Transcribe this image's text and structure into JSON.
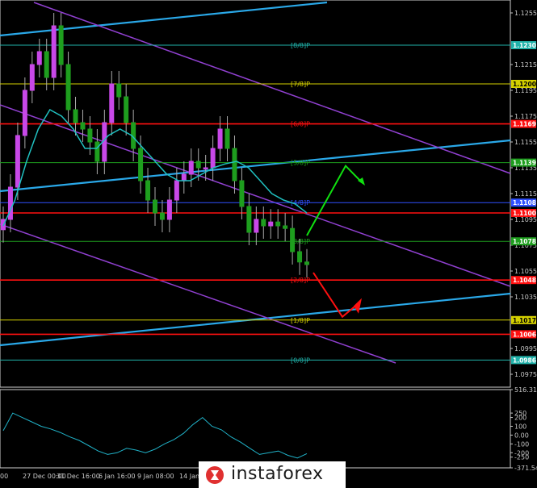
{
  "chart_data": [
    {
      "type": "line",
      "panel": "price",
      "symbol_hint": "candlestick price chart",
      "ylim": [
        1.0965,
        1.1265
      ],
      "y_ticks": [
        "1.1255",
        "1.1215",
        "1.1195",
        "1.1175",
        "1.1155",
        "1.1135",
        "1.1115",
        "1.1095",
        "1.1075",
        "1.1055",
        "1.1035",
        "1.0995",
        "1.0975"
      ],
      "x_ticks": [
        "00",
        "27 Dec 00:00",
        "31 Dec 16:00",
        "6 Jan 16:00",
        "9 Jan 08:00",
        "14 Jan"
      ],
      "murrey_levels": [
        {
          "label": "[8/8]P",
          "value": 1.123,
          "tag": "1.1230",
          "color": "#20b2aa"
        },
        {
          "label": "[7/8]P",
          "value": 1.12,
          "tag": "1.1200",
          "color": "#d4d000"
        },
        {
          "label": "[6/8]P",
          "value": 1.1169,
          "tag": "1.1169",
          "color": "#ff1010"
        },
        {
          "label": "[5/8]P",
          "value": 1.1139,
          "tag": "1.1139",
          "color": "#1e9e1e"
        },
        {
          "label": "[4/8]P",
          "value": 1.1108,
          "tag": "1.1108",
          "color": "#3050ff"
        },
        {
          "label": "",
          "value": 1.11,
          "tag": "1.1100",
          "color": "#ff1010"
        },
        {
          "label": "[3/8]P",
          "value": 1.1078,
          "tag": "1.1078",
          "color": "#1e9e1e"
        },
        {
          "label": "[2/8]P",
          "value": 1.1048,
          "tag": "1.1048",
          "color": "#ff1010"
        },
        {
          "label": "[1/8]P",
          "value": 1.1017,
          "tag": "1.1017",
          "color": "#d4d000"
        },
        {
          "label": "",
          "value": 1.1006,
          "tag": "1.1006",
          "color": "#ff1010"
        },
        {
          "label": "[0/8]P",
          "value": 1.0986,
          "tag": "1.0986",
          "color": "#20b2aa"
        }
      ],
      "candles_close": [
        1.1095,
        1.112,
        1.116,
        1.1195,
        1.1215,
        1.1225,
        1.1205,
        1.1245,
        1.1215,
        1.118,
        1.117,
        1.1165,
        1.1155,
        1.114,
        1.117,
        1.12,
        1.119,
        1.117,
        1.115,
        1.1125,
        1.111,
        1.11,
        1.1095,
        1.111,
        1.1125,
        1.113,
        1.114,
        1.1135,
        1.1135,
        1.115,
        1.1165,
        1.115,
        1.1125,
        1.1105,
        1.1085,
        1.1095,
        1.109,
        1.1093,
        1.109,
        1.1088,
        1.107,
        1.1062,
        1.106
      ],
      "moving_average": [
        1.109,
        1.111,
        1.114,
        1.1165,
        1.118,
        1.1175,
        1.1165,
        1.115,
        1.115,
        1.116,
        1.1165,
        1.116,
        1.115,
        1.114,
        1.113,
        1.1125,
        1.1125,
        1.113,
        1.1135,
        1.1138,
        1.114,
        1.1135,
        1.1125,
        1.1115,
        1.111,
        1.1107,
        1.11
      ],
      "signals": [
        {
          "direction": "up",
          "color": "#10e010"
        },
        {
          "direction": "down",
          "color": "#ff1010"
        }
      ]
    },
    {
      "type": "line",
      "panel": "cci",
      "ylim": [
        -371.5499,
        516.3192
      ],
      "y_ticks": [
        "516.3192",
        "250",
        "200",
        "100",
        "0.00",
        "-100",
        "-200",
        "-250",
        "-371.5499"
      ],
      "values": [
        50,
        250,
        200,
        150,
        100,
        70,
        30,
        -20,
        -60,
        -120,
        -180,
        -220,
        -200,
        -150,
        -170,
        -200,
        -160,
        -100,
        -50,
        20,
        120,
        200,
        100,
        60,
        -20,
        -80,
        -150,
        -220,
        -200,
        -180,
        -230,
        -260,
        -210
      ]
    }
  ],
  "watermark": {
    "brand": "instaforex"
  }
}
